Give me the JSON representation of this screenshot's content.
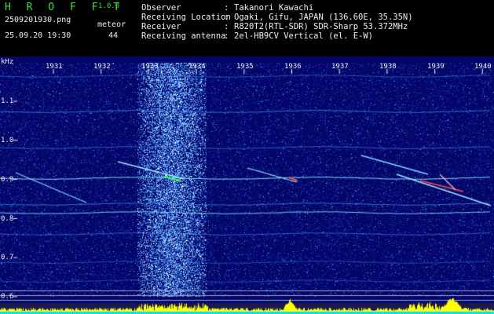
{
  "header": {
    "brand": "H R O F F T",
    "version": "1.0.0",
    "filename": "2509201930.png",
    "meteor_label": "meteor",
    "datetime": "25.09.20 19:30",
    "meteor_count": "44",
    "info": [
      {
        "key": "Observer",
        "value": "Takanori Kawachi"
      },
      {
        "key": "Receiving Location",
        "value": "Ogaki, Gifu, JAPAN (136.60E, 35.35N)"
      },
      {
        "key": "Receiver",
        "value": "R820T2(RTL-SDR) SDR-Sharp 53.372MHz"
      },
      {
        "key": "Receiving antenna",
        "value": "2el-HB9CV Vertical (el. E-W)"
      }
    ]
  },
  "plot": {
    "unit": "kHz",
    "y_ticks": [
      "1.1",
      "1.0",
      "0.9",
      "0.8",
      "0.7",
      "0.6"
    ],
    "x_ticks": [
      "1931",
      "1932",
      "1933",
      "1934",
      "1935",
      "1936",
      "1937",
      "1938",
      "1939",
      "1940"
    ],
    "colors": {
      "background": "#04066a",
      "noise": "#1f5ad8",
      "trace": "#7fd8ff",
      "baseline": "#ffff00"
    }
  }
}
